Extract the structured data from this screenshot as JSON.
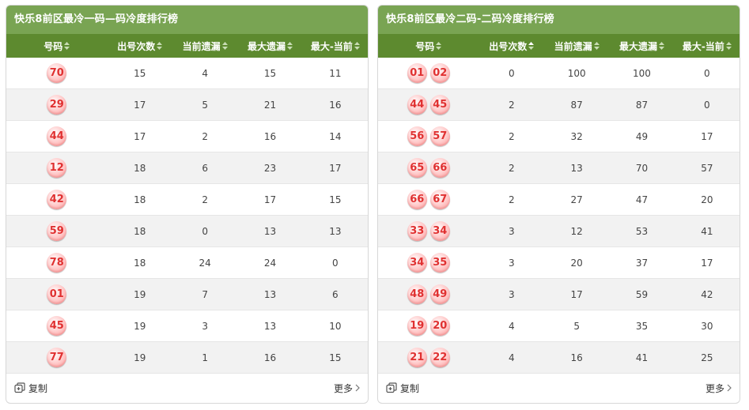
{
  "left": {
    "title": "快乐8前区最冷一码—码冷度排行榜",
    "headers": [
      "号码",
      "出号次数",
      "当前遗漏",
      "最大遗漏",
      "最大-当前"
    ],
    "rows": [
      {
        "codes": [
          "70"
        ],
        "count": "15",
        "current": "4",
        "max": "15",
        "diff": "11"
      },
      {
        "codes": [
          "29"
        ],
        "count": "17",
        "current": "5",
        "max": "21",
        "diff": "16"
      },
      {
        "codes": [
          "44"
        ],
        "count": "17",
        "current": "2",
        "max": "16",
        "diff": "14"
      },
      {
        "codes": [
          "12"
        ],
        "count": "18",
        "current": "6",
        "max": "23",
        "diff": "17"
      },
      {
        "codes": [
          "42"
        ],
        "count": "18",
        "current": "2",
        "max": "17",
        "diff": "15"
      },
      {
        "codes": [
          "59"
        ],
        "count": "18",
        "current": "0",
        "max": "13",
        "diff": "13"
      },
      {
        "codes": [
          "78"
        ],
        "count": "18",
        "current": "24",
        "max": "24",
        "diff": "0"
      },
      {
        "codes": [
          "01"
        ],
        "count": "19",
        "current": "7",
        "max": "13",
        "diff": "6"
      },
      {
        "codes": [
          "45"
        ],
        "count": "19",
        "current": "3",
        "max": "13",
        "diff": "10"
      },
      {
        "codes": [
          "77"
        ],
        "count": "19",
        "current": "1",
        "max": "16",
        "diff": "15"
      }
    ],
    "copy_label": "复制",
    "more_label": "更多"
  },
  "right": {
    "title": "快乐8前区最冷二码-二码冷度排行榜",
    "headers": [
      "号码",
      "出号次数",
      "当前遗漏",
      "最大遗漏",
      "最大-当前"
    ],
    "rows": [
      {
        "codes": [
          "01",
          "02"
        ],
        "count": "0",
        "current": "100",
        "max": "100",
        "diff": "0"
      },
      {
        "codes": [
          "44",
          "45"
        ],
        "count": "2",
        "current": "87",
        "max": "87",
        "diff": "0"
      },
      {
        "codes": [
          "56",
          "57"
        ],
        "count": "2",
        "current": "32",
        "max": "49",
        "diff": "17"
      },
      {
        "codes": [
          "65",
          "66"
        ],
        "count": "2",
        "current": "13",
        "max": "70",
        "diff": "57"
      },
      {
        "codes": [
          "66",
          "67"
        ],
        "count": "2",
        "current": "27",
        "max": "47",
        "diff": "20"
      },
      {
        "codes": [
          "33",
          "34"
        ],
        "count": "3",
        "current": "12",
        "max": "53",
        "diff": "41"
      },
      {
        "codes": [
          "34",
          "35"
        ],
        "count": "3",
        "current": "20",
        "max": "37",
        "diff": "17"
      },
      {
        "codes": [
          "48",
          "49"
        ],
        "count": "3",
        "current": "17",
        "max": "59",
        "diff": "42"
      },
      {
        "codes": [
          "19",
          "20"
        ],
        "count": "4",
        "current": "5",
        "max": "35",
        "diff": "30"
      },
      {
        "codes": [
          "21",
          "22"
        ],
        "count": "4",
        "current": "16",
        "max": "41",
        "diff": "25"
      }
    ],
    "copy_label": "复制",
    "more_label": "更多"
  },
  "colors": {
    "title_bar": "#79a453",
    "header_bar": "#5d8a2f",
    "ball_text": "#e03131",
    "row_alt": "#f2f2f2"
  },
  "icons": {
    "sort": "sort-updown-icon",
    "copy": "copy-icon",
    "more": "chevron-right-icon"
  }
}
